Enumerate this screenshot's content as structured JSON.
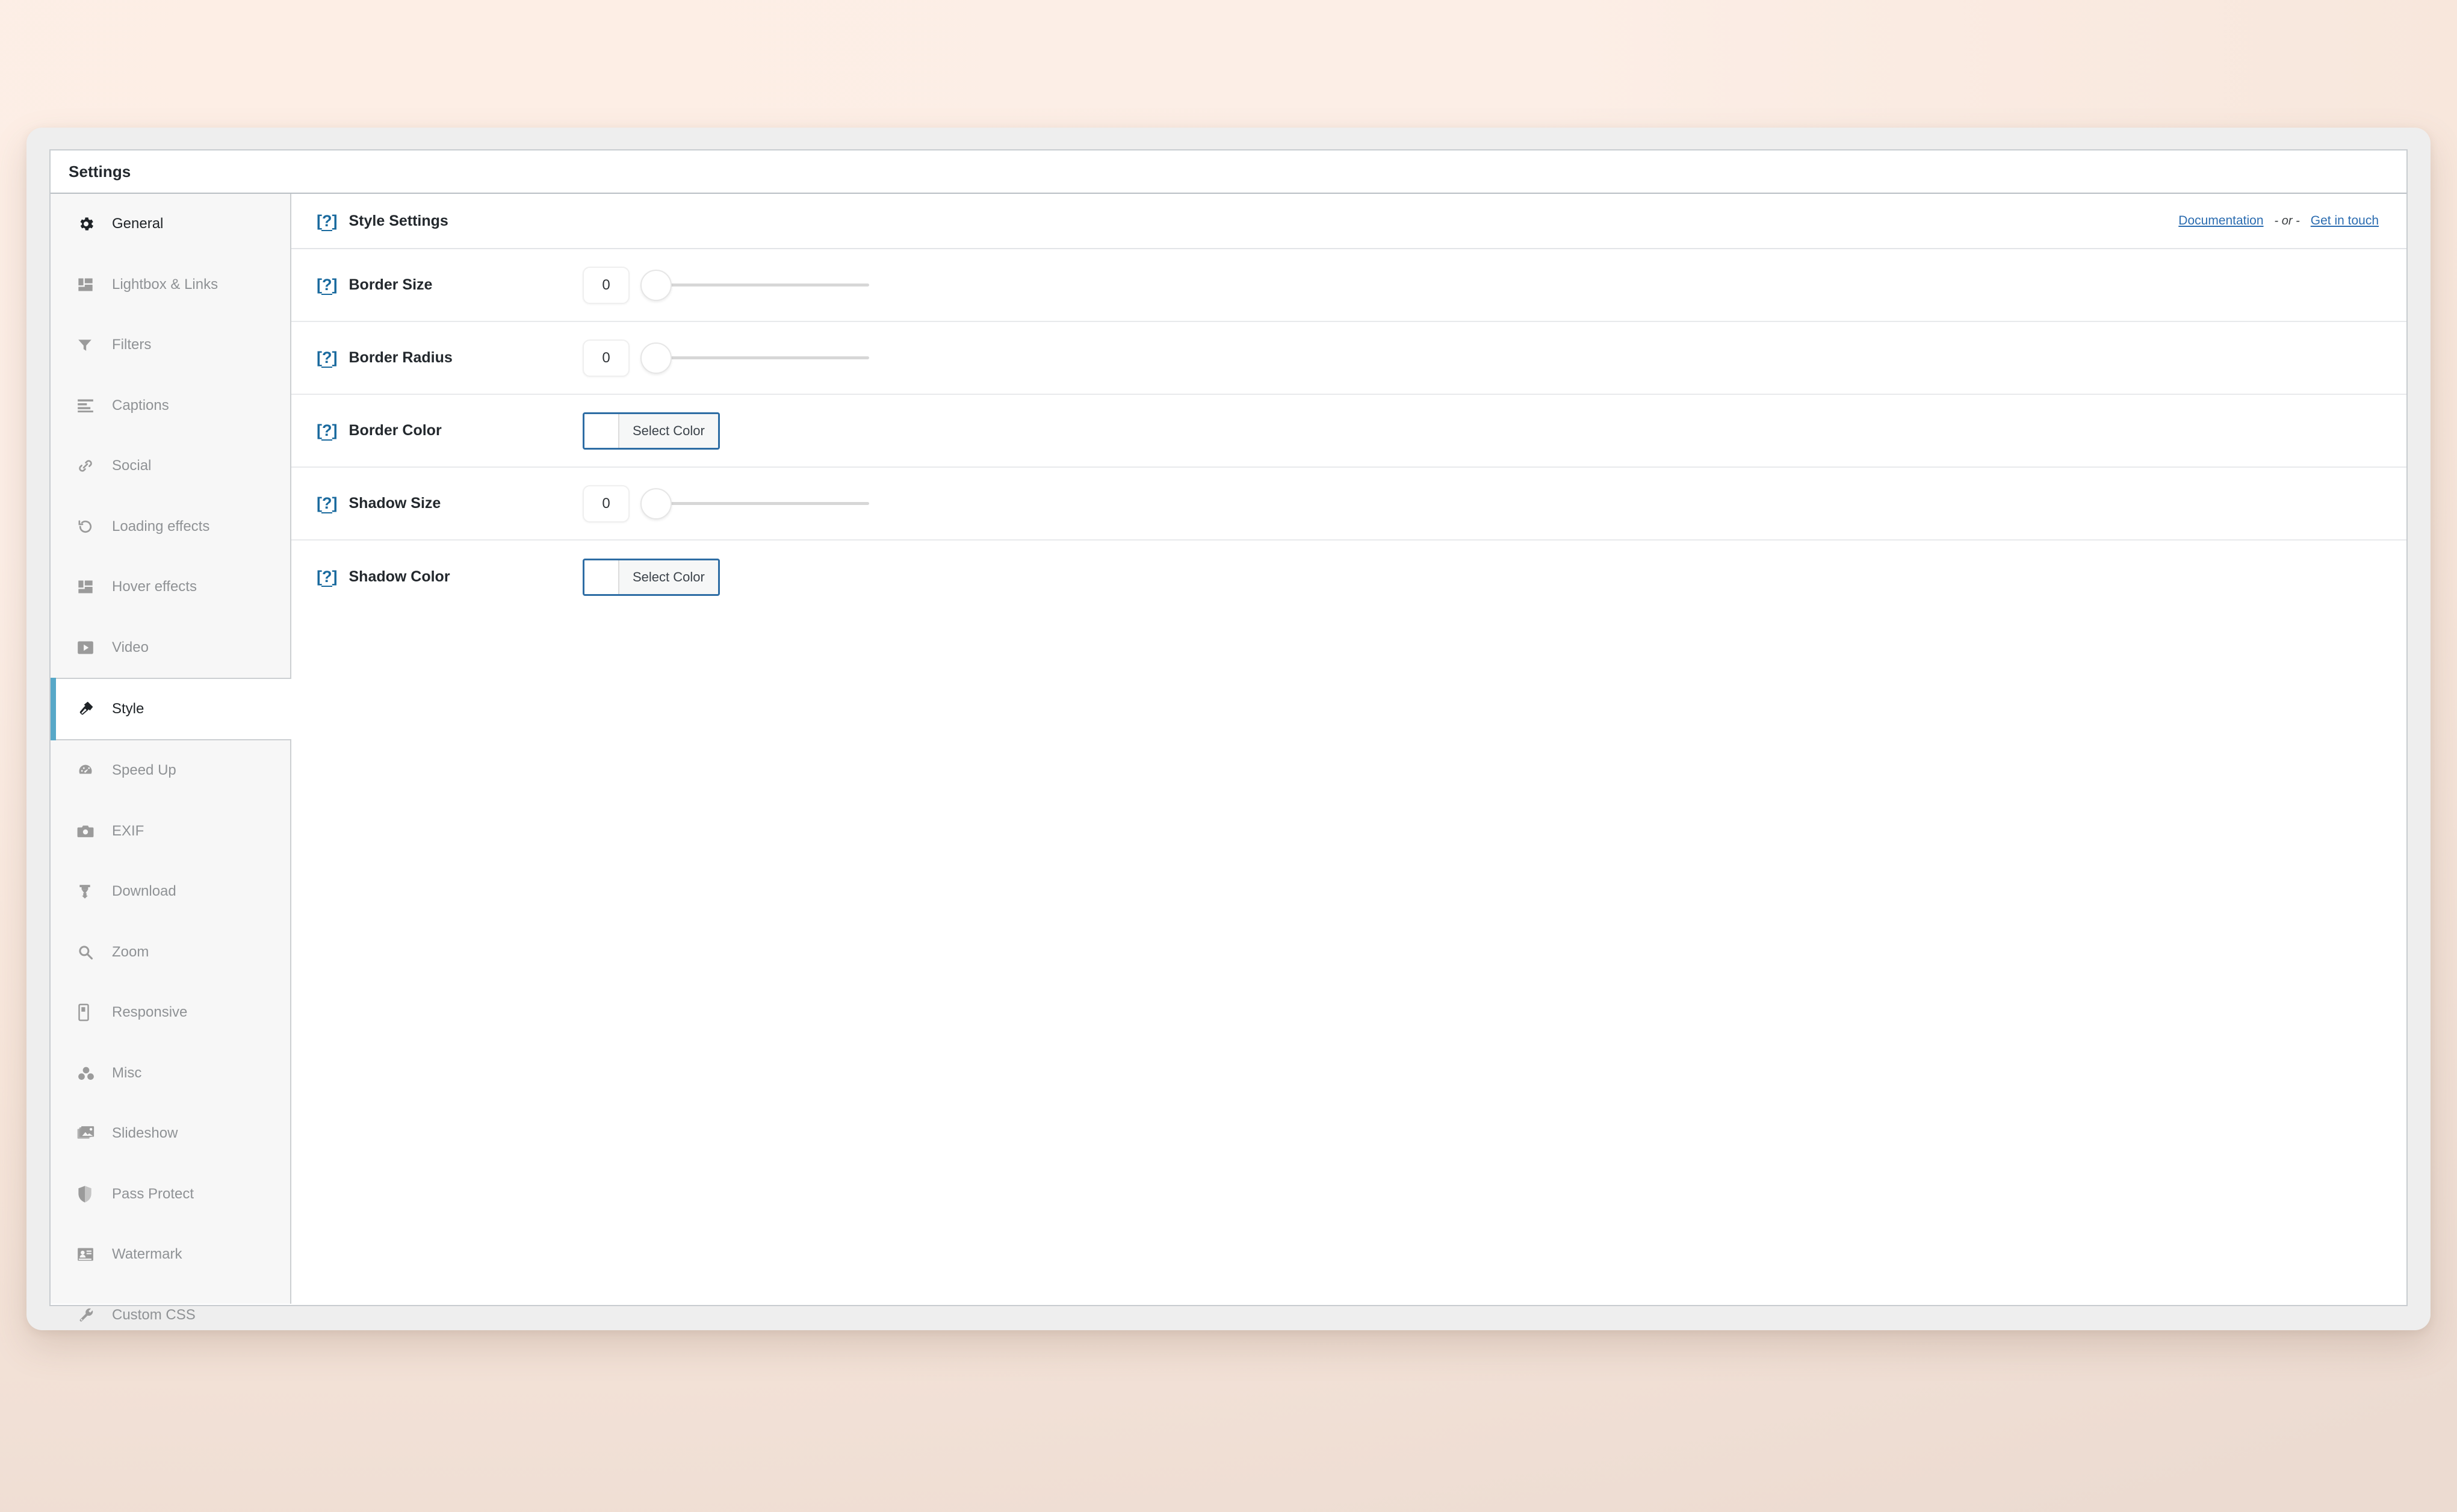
{
  "window": {
    "title": "Settings"
  },
  "sidebar": {
    "items": [
      {
        "label": "General",
        "icon": "gear-icon",
        "active": false
      },
      {
        "label": "Lightbox & Links",
        "icon": "layout-grid-icon",
        "active": false
      },
      {
        "label": "Filters",
        "icon": "funnel-icon",
        "active": false
      },
      {
        "label": "Captions",
        "icon": "text-lines-icon",
        "active": false
      },
      {
        "label": "Social",
        "icon": "link-chain-icon",
        "active": false
      },
      {
        "label": "Loading effects",
        "icon": "refresh-arrow-icon",
        "active": false
      },
      {
        "label": "Hover effects",
        "icon": "layout-grid-icon",
        "active": false
      },
      {
        "label": "Video",
        "icon": "play-video-icon",
        "active": false
      },
      {
        "label": "Style",
        "icon": "hammer-icon",
        "active": true
      },
      {
        "label": "Speed Up",
        "icon": "gauge-icon",
        "active": false
      },
      {
        "label": "EXIF",
        "icon": "camera-icon",
        "active": false
      },
      {
        "label": "Download",
        "icon": "download-icon",
        "active": false
      },
      {
        "label": "Zoom",
        "icon": "magnifier-icon",
        "active": false
      },
      {
        "label": "Responsive",
        "icon": "mobile-phone-icon",
        "active": false
      },
      {
        "label": "Misc",
        "icon": "three-dots-icon",
        "active": false
      },
      {
        "label": "Slideshow",
        "icon": "images-stack-icon",
        "active": false
      },
      {
        "label": "Pass Protect",
        "icon": "shield-icon",
        "active": false
      },
      {
        "label": "Watermark",
        "icon": "id-card-icon",
        "active": false
      },
      {
        "label": "Custom CSS",
        "icon": "wrench-icon",
        "active": false
      }
    ]
  },
  "content": {
    "header": {
      "help_badge": "[?]",
      "title": "Style Settings",
      "documentation_link": "Documentation",
      "separator": "- or -",
      "contact_link": "Get in touch"
    },
    "rows": [
      {
        "help_badge": "[?]",
        "label": "Border Size",
        "control": "slider",
        "value": "0",
        "slider_percent": 0
      },
      {
        "help_badge": "[?]",
        "label": "Border Radius",
        "control": "slider",
        "value": "0",
        "slider_percent": 0
      },
      {
        "help_badge": "[?]",
        "label": "Border Color",
        "control": "color",
        "button_label": "Select Color",
        "swatch_color": "#ffffff"
      },
      {
        "help_badge": "[?]",
        "label": "Shadow Size",
        "control": "slider",
        "value": "0",
        "slider_percent": 0
      },
      {
        "help_badge": "[?]",
        "label": "Shadow Color",
        "control": "color",
        "button_label": "Select Color",
        "swatch_color": "#ffffff"
      }
    ]
  },
  "colors": {
    "accent_active": "#57a8c8",
    "link_blue": "#2b6cb0",
    "help_blue": "#1a6a9e",
    "color_picker_border": "#2e6da4",
    "sidebar_bg": "#f7f7f7",
    "page_bg": "#fceee6"
  }
}
